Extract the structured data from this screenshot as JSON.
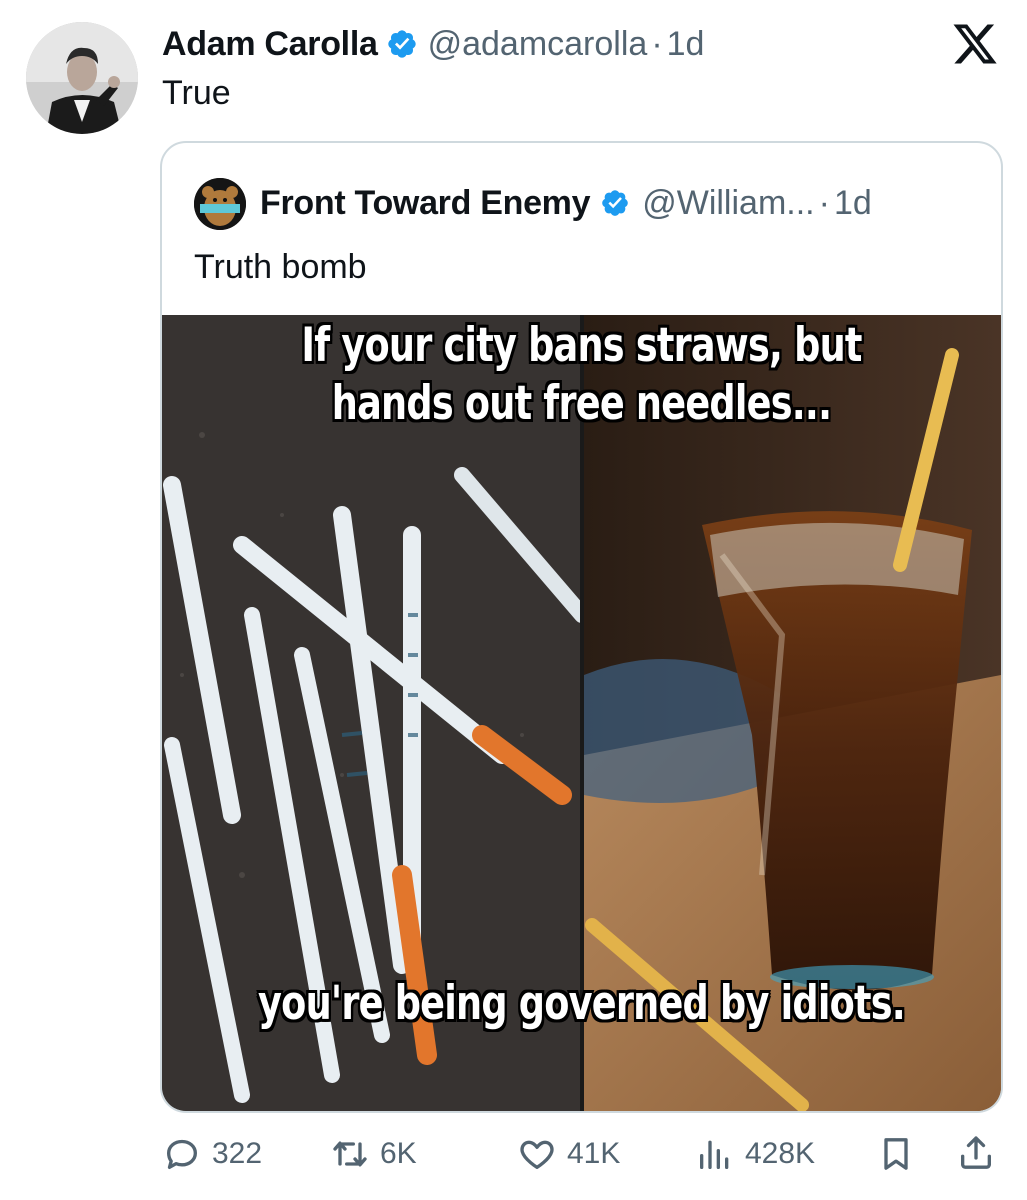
{
  "tweet": {
    "author_name": "Adam Carolla",
    "author_handle": "@adamcarolla",
    "separator": "·",
    "time": "1d",
    "text": "True"
  },
  "quoted_tweet": {
    "author_name": "Front Toward Enemy",
    "author_handle": "@William...",
    "separator": "·",
    "time": "1d",
    "text": "Truth bomb",
    "image": {
      "caption_top": "If your city bans straws, but hands out free needles...",
      "caption_bottom": "you're being governed by idiots."
    }
  },
  "actions": {
    "replies": "322",
    "reposts": "6K",
    "likes": "41K",
    "views": "428K"
  },
  "icons": {
    "verified": "verified-badge-icon",
    "platform": "x-logo-icon",
    "reply": "reply-icon",
    "repost": "repost-icon",
    "like": "heart-icon",
    "views": "views-icon",
    "bookmark": "bookmark-icon",
    "share": "share-icon"
  },
  "colors": {
    "verified_blue": "#1d9bf0",
    "text_primary": "#0f1419",
    "text_secondary": "#536471",
    "border": "#cfd9de"
  }
}
